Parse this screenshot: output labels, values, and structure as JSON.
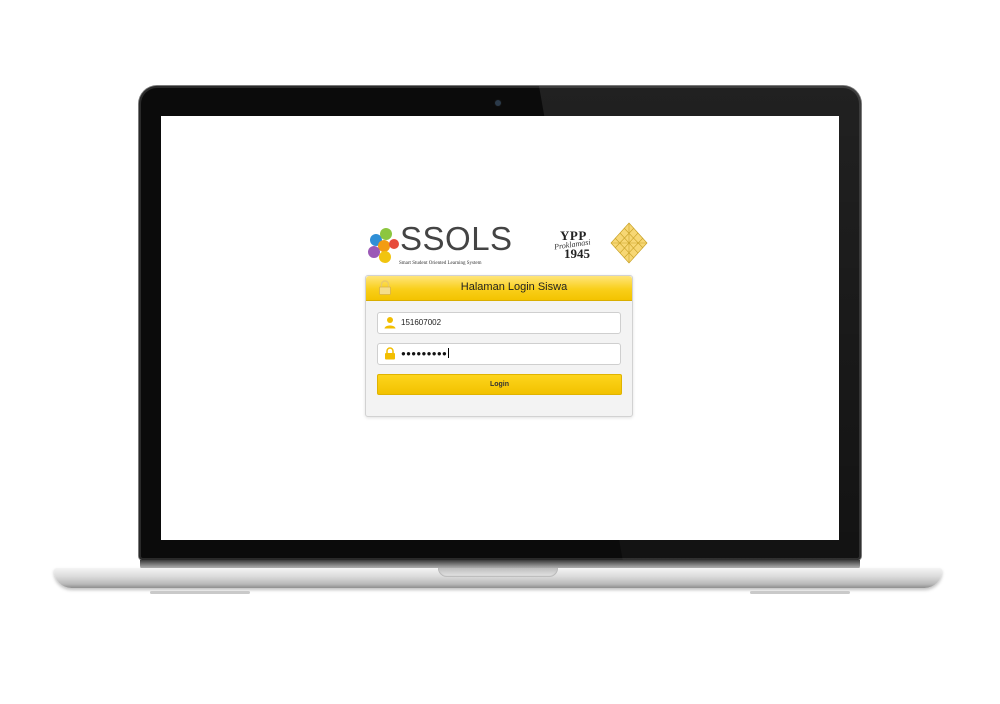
{
  "branding": {
    "app_logo_text": "SSOLS",
    "app_tagline": "Smart Student Oriented Learning System",
    "partner_logo_text": "YPP",
    "partner_logo_script": "Proklamasi",
    "partner_logo_year": "1945"
  },
  "login_panel": {
    "title": "Halaman Login Siswa",
    "username_value": "151607002",
    "password_value": "●●●●●●●●●",
    "login_button_label": "Login"
  },
  "icons": {
    "header": "lock-icon",
    "username": "user-icon",
    "password": "padlock-icon"
  },
  "colors": {
    "accent_yellow": "#f7c800",
    "panel_background": "#f3f3f3",
    "laptop_bezel": "#0b0b0b"
  }
}
